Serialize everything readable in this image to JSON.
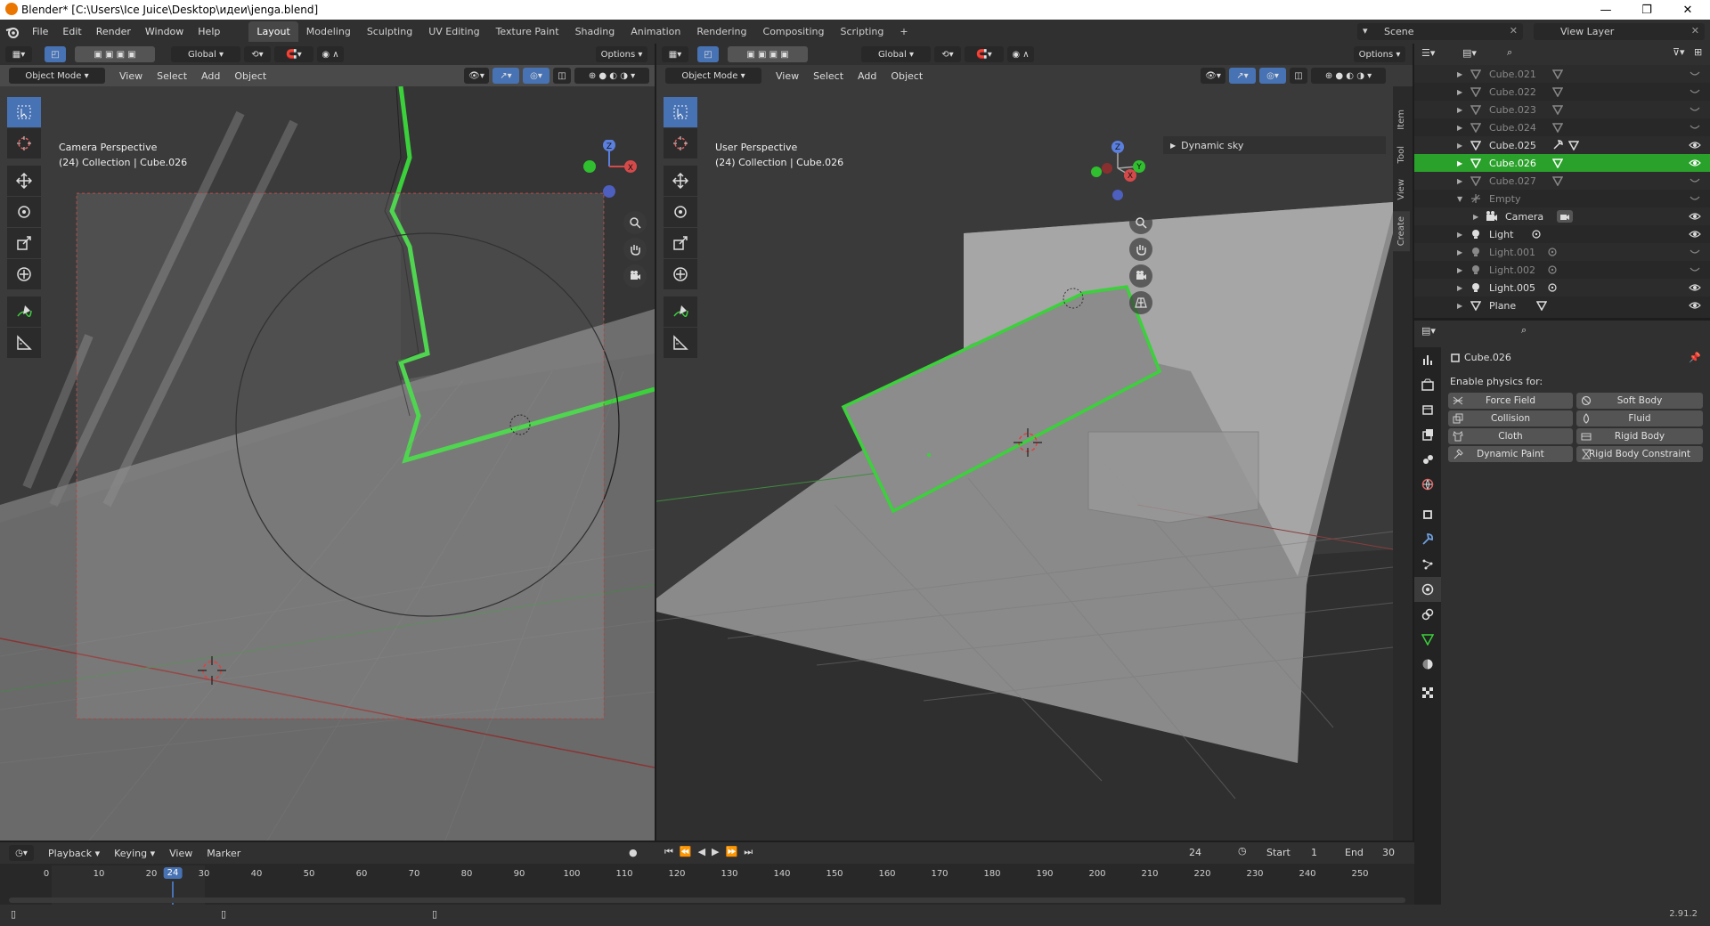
{
  "window": {
    "title": "Blender* [C:\\Users\\Ice Juice\\Desktop\\идеи\\jenga.blend]",
    "minimize": "—",
    "restore": "❐",
    "close": "✕"
  },
  "menu": [
    "File",
    "Edit",
    "Render",
    "Window",
    "Help"
  ],
  "workspaces": [
    "Layout",
    "Modeling",
    "Sculpting",
    "UV Editing",
    "Texture Paint",
    "Shading",
    "Animation",
    "Rendering",
    "Compositing",
    "Scripting",
    "+"
  ],
  "scene": {
    "name": "Scene",
    "view_layer": "View Layer"
  },
  "viewport_left": {
    "transform": "Global",
    "options": "Options",
    "mode": "Object Mode",
    "menus": [
      "View",
      "Select",
      "Add",
      "Object"
    ],
    "perspective": "Camera Perspective",
    "collection": "(24) Collection | Cube.026",
    "gizmo": {
      "z": "Z",
      "x": "X"
    }
  },
  "viewport_right": {
    "transform": "Global",
    "options": "Options",
    "mode": "Object Mode",
    "menus": [
      "View",
      "Select",
      "Add",
      "Object"
    ],
    "perspective": "User Perspective",
    "collection": "(24) Collection | Cube.026",
    "panel": "Dynamic sky",
    "side_tabs": [
      "Item",
      "Tool",
      "View",
      "Create"
    ],
    "gizmo": {
      "z": "Z",
      "x": "X",
      "y": "Y"
    }
  },
  "outliner": {
    "rows": [
      {
        "name": "Cube.021",
        "dim": true,
        "eye": false
      },
      {
        "name": "Cube.022",
        "dim": true,
        "eye": false
      },
      {
        "name": "Cube.023",
        "dim": true,
        "eye": false
      },
      {
        "name": "Cube.024",
        "dim": true,
        "eye": false
      },
      {
        "name": "Cube.025",
        "dim": false,
        "eye": true
      },
      {
        "name": "Cube.026",
        "dim": false,
        "eye": true,
        "selected": true
      },
      {
        "name": "Cube.027",
        "dim": true,
        "eye": false
      },
      {
        "name": "Empty",
        "dim": true,
        "eye": false
      },
      {
        "name": "Camera",
        "dim": false,
        "eye": true
      },
      {
        "name": "Light",
        "dim": false,
        "eye": true
      },
      {
        "name": "Light.001",
        "dim": true,
        "eye": false
      },
      {
        "name": "Light.002",
        "dim": true,
        "eye": false
      },
      {
        "name": "Light.005",
        "dim": false,
        "eye": true
      },
      {
        "name": "Plane",
        "dim": false,
        "eye": true
      }
    ]
  },
  "properties": {
    "object": "Cube.026",
    "enable_label": "Enable physics for:",
    "buttons": [
      "Force Field",
      "Soft Body",
      "Collision",
      "Fluid",
      "Cloth",
      "Rigid Body",
      "Dynamic Paint",
      "Rigid Body Constraint"
    ]
  },
  "timeline": {
    "menus": [
      "Playback",
      "Keying",
      "View",
      "Marker"
    ],
    "current_frame": "24",
    "start_label": "Start",
    "start": "1",
    "end_label": "End",
    "end": "30",
    "ticks": [
      "0",
      "10",
      "20",
      "24",
      "30",
      "40",
      "50",
      "60",
      "70",
      "80",
      "90",
      "100",
      "110",
      "120",
      "130",
      "140",
      "150",
      "160",
      "170",
      "180",
      "190",
      "200",
      "210",
      "220",
      "230",
      "240",
      "250"
    ]
  },
  "status": {
    "version": "2.91.2"
  }
}
